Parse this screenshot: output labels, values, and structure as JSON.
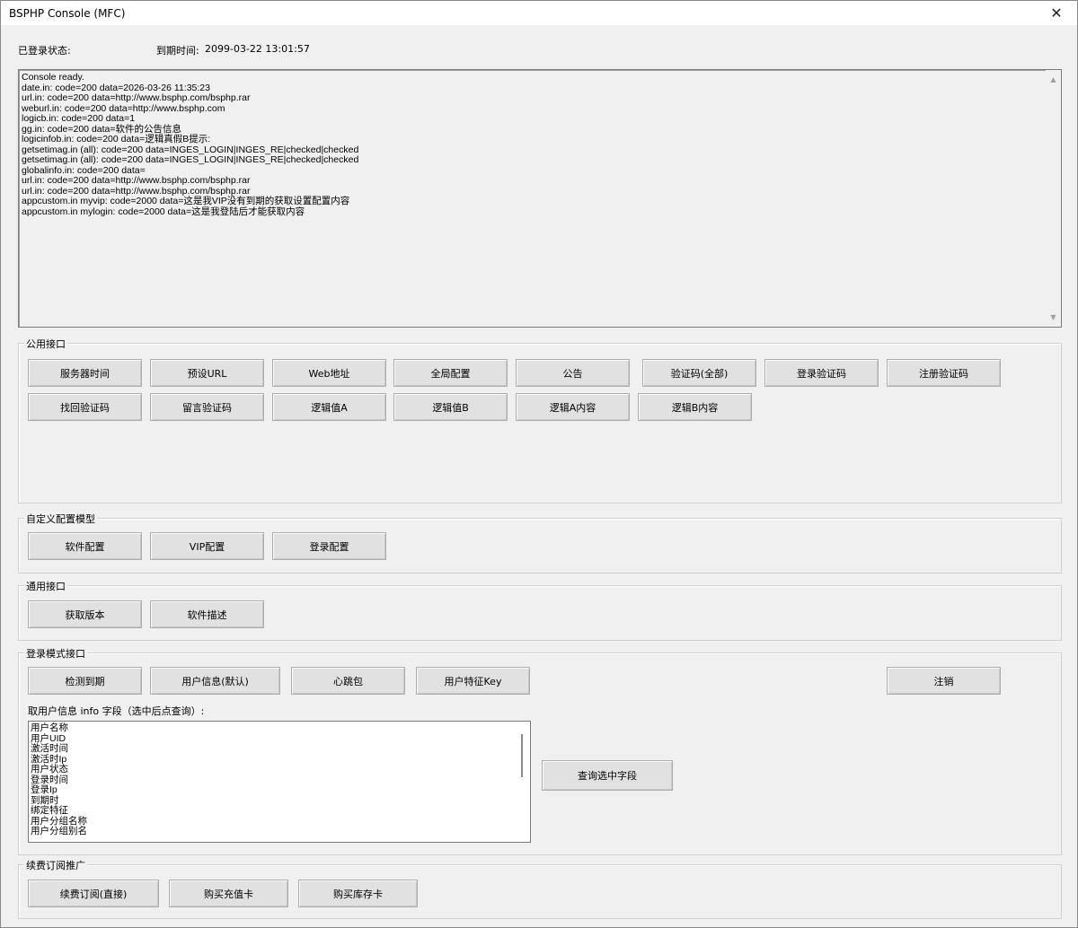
{
  "window": {
    "title": "BSPHP Console (MFC)",
    "close_glyph": "✕"
  },
  "status": {
    "login_label": "已登录状态:",
    "expire_label": "到期时间:",
    "expire_value": "2099-03-22 13:01:57"
  },
  "console": {
    "lines": [
      "Console ready.",
      "date.in: code=200 data=2026-03-26 11:35:23",
      "url.in: code=200 data=http://www.bsphp.com/bsphp.rar",
      "weburl.in: code=200 data=http://www.bsphp.com",
      "logicb.in: code=200 data=1",
      "gg.in: code=200 data=软件的公告信息",
      "logicinfob.in: code=200 data=逻辑真假B提示:",
      "getsetimag.in (all): code=200 data=INGES_LOGIN|INGES_RE|checked|checked",
      "getsetimag.in (all): code=200 data=INGES_LOGIN|INGES_RE|checked|checked",
      "globalinfo.in: code=200 data=",
      "url.in: code=200 data=http://www.bsphp.com/bsphp.rar",
      "url.in: code=200 data=http://www.bsphp.com/bsphp.rar",
      "appcustom.in myvip: code=2000 data=这是我VIP没有到期的获取设置配置内容",
      "appcustom.in mylogin: code=2000 data=这是我登陆后才能获取内容"
    ]
  },
  "public_api": {
    "label": "公用接口",
    "buttons": [
      "服务器时间",
      "预设URL",
      "Web地址",
      "全局配置",
      "公告",
      "验证码(全部)",
      "登录验证码",
      "注册验证码",
      "找回验证码",
      "留言验证码",
      "逻辑值A",
      "逻辑值B",
      "逻辑A内容",
      "逻辑B内容"
    ]
  },
  "custom_config": {
    "label": "自定义配置模型",
    "buttons": [
      "软件配置",
      "VIP配置",
      "登录配置"
    ]
  },
  "general_api": {
    "label": "通用接口",
    "buttons": [
      "获取版本",
      "软件描述"
    ]
  },
  "login_api": {
    "label": "登录模式接口",
    "buttons": [
      "检测到期",
      "用户信息(默认)",
      "心跳包",
      "用户特征Key"
    ],
    "logout": "注销",
    "info_label": "取用户信息 info 字段（选中后点查询）:",
    "fields": [
      "用户名称",
      "用户UID",
      "激活时间",
      "激活时Ip",
      "用户状态",
      "登录时间",
      "登录Ip",
      "到期时",
      "绑定特征",
      "用户分组名称",
      "用户分组别名"
    ],
    "query_button": "查询选中字段"
  },
  "renew": {
    "label": "续费订阅推广",
    "buttons": [
      "续费订阅(直接)",
      "购买充值卡",
      "购买库存卡"
    ]
  }
}
